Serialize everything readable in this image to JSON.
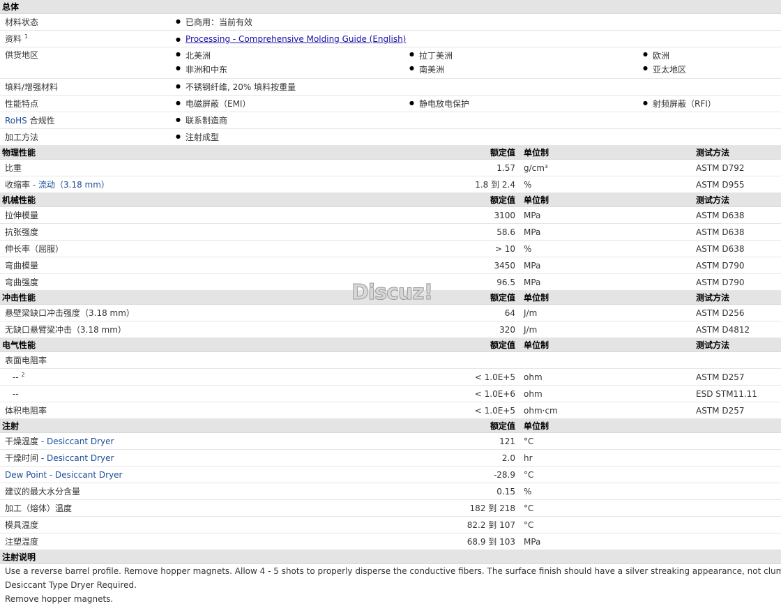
{
  "general": {
    "title": "总体",
    "rows": [
      {
        "label": "材料状态",
        "items": [
          "已商用：当前有效"
        ]
      },
      {
        "label": "资料",
        "sup": "1",
        "link": "Processing - Comprehensive Molding Guide (English)"
      },
      {
        "label": "供货地区",
        "items": [
          "北美洲",
          "拉丁美洲",
          "欧洲",
          "非洲和中东",
          "南美洲",
          "亚太地区"
        ]
      },
      {
        "label": "填料/增强材料",
        "items": [
          "不锈钢纤维, 20% 填料按重量"
        ]
      },
      {
        "label": "性能特点",
        "items": [
          "电磁屏蔽（EMI）",
          "静电放电保护",
          "射频屏蔽（RFI）"
        ]
      },
      {
        "label_en": "RoHS",
        "label": "合规性",
        "items": [
          "联系制造商"
        ]
      },
      {
        "label": "加工方法",
        "items": [
          "注射成型"
        ]
      }
    ]
  },
  "headers": {
    "nominal": "额定值",
    "unit": "单位制",
    "method": "测试方法"
  },
  "physical": {
    "title": "物理性能",
    "rows": [
      {
        "label": "比重",
        "value": "1.57",
        "unit": "g/cm³",
        "method": "ASTM D792"
      },
      {
        "label": "收缩率",
        "cond": "- 流动（3.18 mm）",
        "value": "1.8 到  2.4",
        "unit": "%",
        "method": "ASTM D955"
      }
    ]
  },
  "mechanical": {
    "title": "机械性能",
    "rows": [
      {
        "label": "拉伸模量",
        "value": "3100",
        "unit": "MPa",
        "method": "ASTM D638"
      },
      {
        "label": "抗张强度",
        "value": "58.6",
        "unit": "MPa",
        "method": "ASTM D638"
      },
      {
        "label": "伸长率（屈服）",
        "value": "> 10",
        "unit": "%",
        "method": "ASTM D638"
      },
      {
        "label": "弯曲模量",
        "value": "3450",
        "unit": "MPa",
        "method": "ASTM D790"
      },
      {
        "label": "弯曲强度",
        "value": "96.5",
        "unit": "MPa",
        "method": "ASTM D790"
      }
    ]
  },
  "impact": {
    "title": "冲击性能",
    "rows": [
      {
        "label": "悬壁梁缺口冲击强度（3.18 mm）",
        "value": "64",
        "unit": "J/m",
        "method": "ASTM D256"
      },
      {
        "label": "无缺口悬臂梁冲击（3.18 mm）",
        "value": "320",
        "unit": "J/m",
        "method": "ASTM D4812"
      }
    ]
  },
  "electrical": {
    "title": "电气性能",
    "rows": [
      {
        "label": "表面电阻率",
        "value": "",
        "unit": "",
        "method": ""
      },
      {
        "label": "--",
        "sup": "2",
        "value": "< 1.0E+5",
        "unit": "ohm",
        "method": "ASTM D257"
      },
      {
        "label": "--",
        "value": "< 1.0E+6",
        "unit": "ohm",
        "method": "ESD STM11.11"
      },
      {
        "label": "体积电阻率",
        "value": "< 1.0E+5",
        "unit": "ohm·cm",
        "method": "ASTM D257"
      }
    ]
  },
  "injection": {
    "title": "注射",
    "rows": [
      {
        "label": "干燥温度",
        "cond": "- Desiccant Dryer",
        "value": "121",
        "unit": "°C"
      },
      {
        "label": "干燥时间",
        "cond": "- Desiccant Dryer",
        "value": "2.0",
        "unit": "hr"
      },
      {
        "label_en": "Dew Point - Desiccant Dryer",
        "value": "-28.9",
        "unit": "°C"
      },
      {
        "label": "建议的最大水分含量",
        "value": "0.15",
        "unit": "%"
      },
      {
        "label": "加工（熔体）温度",
        "value": "182 到  218",
        "unit": "°C"
      },
      {
        "label": "模具温度",
        "value": "82.2 到  107",
        "unit": "°C"
      },
      {
        "label": "注塑温度",
        "value": "68.9 到  103",
        "unit": "MPa"
      }
    ]
  },
  "notes": {
    "title": "注射说明",
    "lines": [
      "Use a reverse barrel profile. Remove hopper magnets. Allow 4 - 5 shots to properly disperse the conductive fibers. The surface finish should have a silver streaking appearance, not clumps.",
      "Desiccant Type Dryer Required.",
      "Remove hopper magnets."
    ]
  },
  "watermark": "Discuz!"
}
